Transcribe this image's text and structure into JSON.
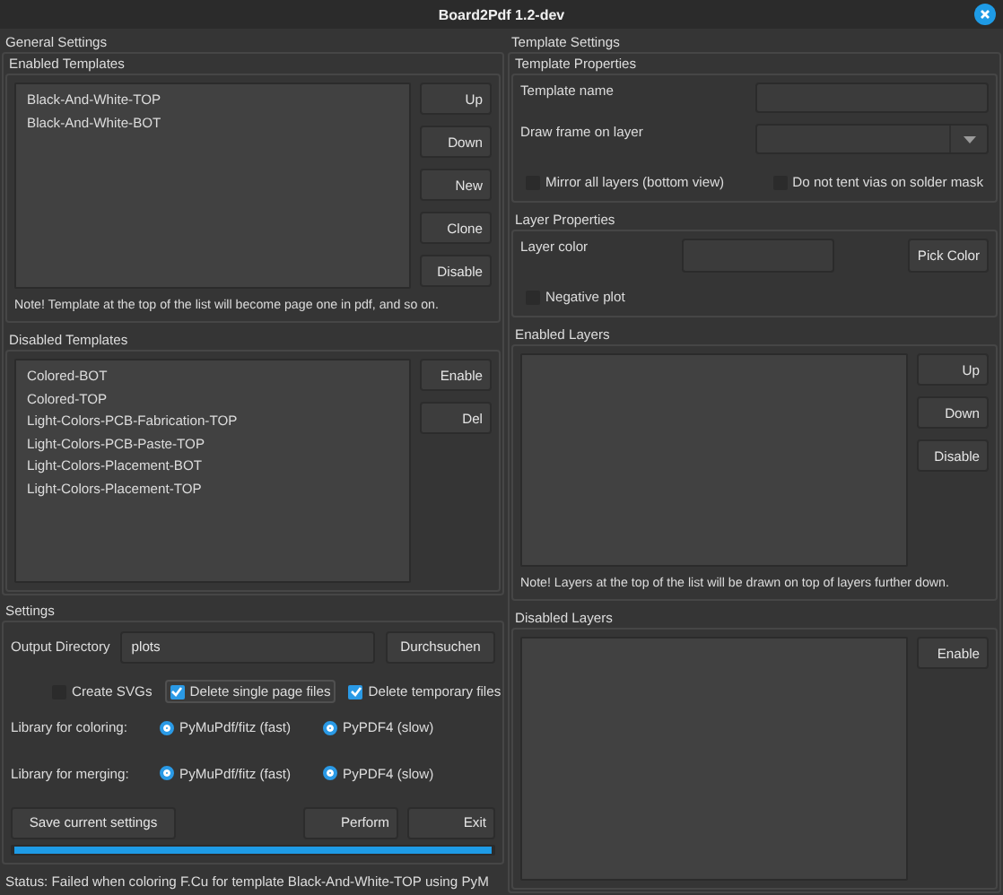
{
  "window": {
    "title": "Board2Pdf 1.2-dev"
  },
  "general_settings": {
    "title": "General Settings",
    "enabled_templates": {
      "title": "Enabled Templates",
      "items": [
        {
          "label": "Black-And-White-TOP",
          "selected": false
        },
        {
          "label": "Black-And-White-BOT",
          "selected": false
        }
      ],
      "buttons": [
        "Up",
        "Down",
        "New",
        "Clone",
        "Disable"
      ],
      "note": "Note! Template at the top of the list will become page one in pdf, and so on."
    },
    "disabled_templates": {
      "title": "Disabled Templates",
      "items": [
        {
          "label": "Colored-BOT",
          "selected": false
        },
        {
          "label": "Colored-TOP",
          "selected": false
        },
        {
          "label": "Light-Colors-PCB-Fabrication-TOP",
          "selected": false
        },
        {
          "label": "Light-Colors-PCB-Paste-TOP",
          "selected": false
        },
        {
          "label": "Light-Colors-Placement-BOT",
          "selected": false
        },
        {
          "label": "Light-Colors-Placement-TOP",
          "selected": false
        }
      ],
      "buttons": [
        "Enable",
        "Del"
      ]
    }
  },
  "settings": {
    "title": "Settings",
    "output_directory": {
      "label": "Output Directory",
      "value": "plots",
      "button": "Durchsuchen"
    },
    "checkboxes": [
      {
        "label": "Create SVGs",
        "checked": false,
        "focused": false
      },
      {
        "label": "Delete single page files",
        "checked": true,
        "focused": true
      },
      {
        "label": "Delete temporary files",
        "checked": true,
        "focused": false
      }
    ],
    "radio_groups": [
      {
        "label": "Library for coloring:",
        "options": [
          {
            "label": "PyMuPdf/fitz (fast)",
            "selected": true
          },
          {
            "label": "PyPDF4 (slow)",
            "selected": true
          }
        ]
      },
      {
        "label": "Library for merging:",
        "options": [
          {
            "label": "PyMuPdf/fitz (fast)",
            "selected": true
          },
          {
            "label": "PyPDF4 (slow)",
            "selected": true
          }
        ]
      }
    ],
    "buttons": [
      "Save current settings",
      "Perform",
      "Exit"
    ],
    "progress": {
      "level": 1
    }
  },
  "status": "Status: Failed when coloring F.Cu for template Black-And-White-TOP using PyM",
  "template_settings": {
    "title": "Template Settings",
    "template_properties": {
      "title": "Template Properties",
      "template_name": {
        "label": "Template name"
      },
      "draw_frame": {
        "label": "Draw frame on layer"
      },
      "checkboxes": [
        {
          "label": "Mirror all layers (bottom view)",
          "checked": false,
          "focused": false
        },
        {
          "label": "Do not tent vias on solder mask",
          "checked": false,
          "focused": false
        }
      ]
    },
    "layer_properties": {
      "title": "Layer Properties",
      "layer_color": {
        "label": "Layer color"
      },
      "button": "Pick Color",
      "checkboxes": [
        {
          "label": "Negative plot",
          "checked": false,
          "focused": false
        }
      ]
    },
    "enabled_layers": {
      "title": "Enabled Layers",
      "buttons": [
        "Up",
        "Down",
        "Disable"
      ],
      "note": "Note! Layers at the top of the list will be drawn on top of layers further down."
    },
    "disabled_layers": {
      "title": "Disabled Layers",
      "buttons": [
        "Enable"
      ]
    }
  }
}
